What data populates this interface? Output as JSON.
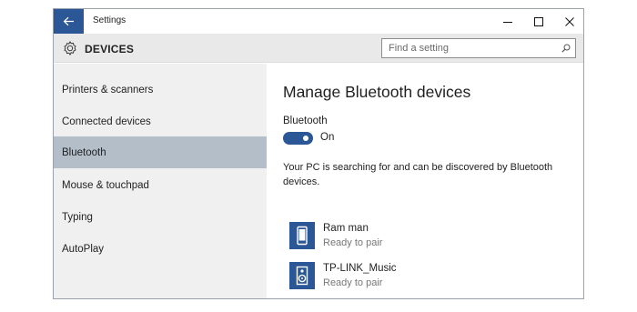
{
  "window": {
    "title": "Settings"
  },
  "header": {
    "section_title": "DEVICES",
    "search_placeholder": "Find a setting"
  },
  "sidebar": {
    "items": [
      {
        "label": "Printers & scanners",
        "active": false
      },
      {
        "label": "Connected devices",
        "active": false
      },
      {
        "label": "Bluetooth",
        "active": true
      },
      {
        "label": "Mouse & touchpad",
        "active": false
      },
      {
        "label": "Typing",
        "active": false
      },
      {
        "label": "AutoPlay",
        "active": false
      }
    ]
  },
  "main": {
    "title": "Manage Bluetooth devices",
    "bluetooth_label": "Bluetooth",
    "toggle_state": "On",
    "toggle_on": true,
    "description": "Your PC is searching for and can be discovered by Bluetooth devices.",
    "devices": [
      {
        "name": "Ram man",
        "status": "Ready to pair",
        "icon": "phone-icon"
      },
      {
        "name": "TP-LINK_Music",
        "status": "Ready to pair",
        "icon": "speaker-icon"
      }
    ]
  },
  "colors": {
    "accent": "#2b5797",
    "selected_nav": "#b4bec8",
    "sidebar_bg": "#f0f0f0",
    "header_bg": "#e9e9e9"
  },
  "icons": [
    "back-arrow-icon",
    "gear-icon",
    "search-icon",
    "minimize-icon",
    "maximize-icon",
    "close-icon"
  ]
}
